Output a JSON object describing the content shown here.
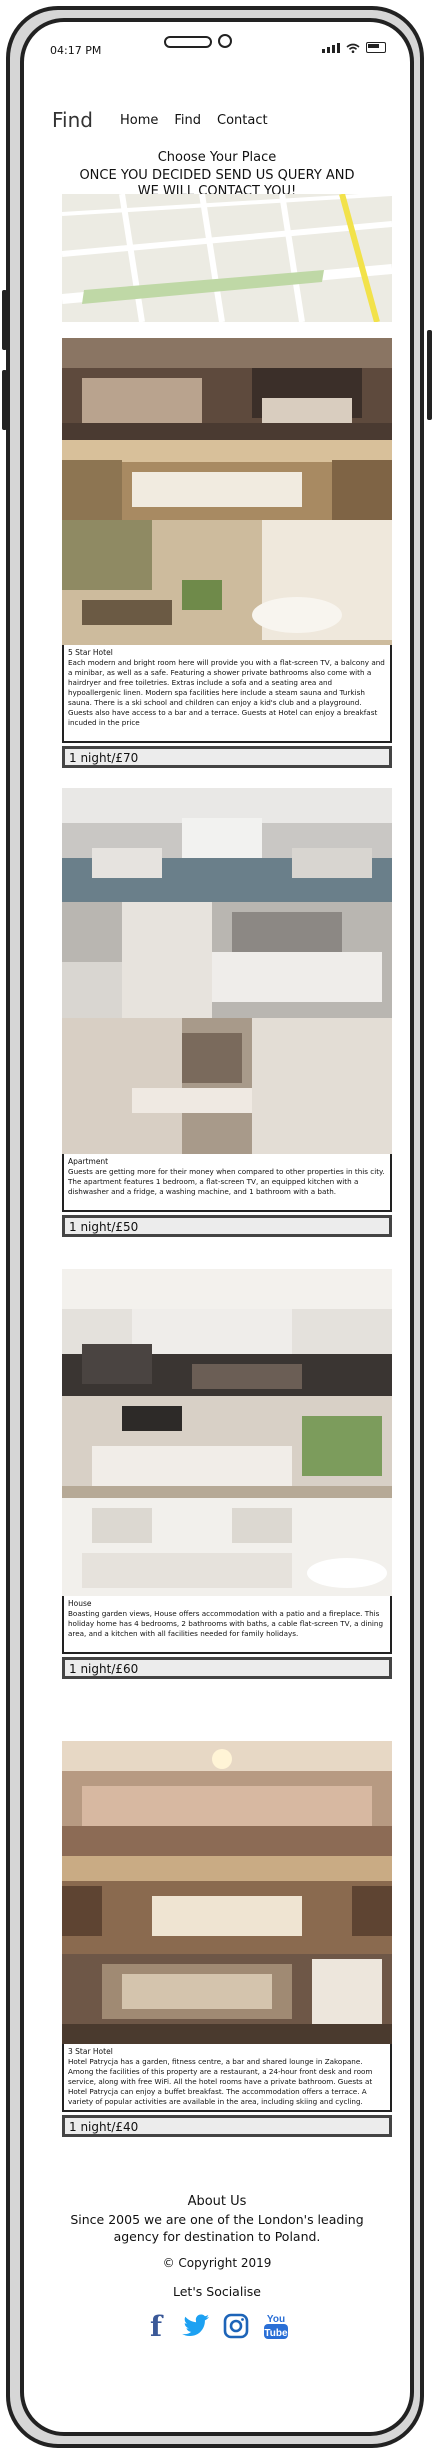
{
  "status": {
    "time": "04:17 PM"
  },
  "nav": {
    "brand": "Find",
    "links": [
      "Home",
      "Find",
      "Contact"
    ]
  },
  "hero": {
    "heading": "Choose Your Place",
    "line1": "ONCE YOU DECIDED SEND US QUERY AND",
    "line2": "WE WILL CONTACT YOU!"
  },
  "listings": [
    {
      "title": "5 Star Hotel",
      "description": "Each modern and bright room here will provide you with a flat-screen TV, a balcony and a minibar, as well as a safe. Featuring a shower private bathrooms also come with a hairdryer and free toiletries. Extras include a sofa and a seating area and hypoallergenic linen. Modern spa facilities here include a steam sauna and Turkish sauna. There is a ski school and children can enjoy a kid's club and a playground. Guests also have access to a bar and a terrace. Guests at Hotel can enjoy a breakfast incuded in the price",
      "price": "1 night/£70"
    },
    {
      "title": "Apartment",
      "description": "Guests are getting more for their money when compared to other properties in this city. The apartment features 1 bedroom, a flat-screen TV, an equipped kitchen with a dishwasher and a fridge, a washing machine, and 1 bathroom with a bath.",
      "price": "1 night/£50"
    },
    {
      "title": "House",
      "description": "Boasting garden views, House offers accommodation with a patio and a fireplace. This holiday home has 4 bedrooms, 2 bathrooms with baths, a cable flat-screen TV, a dining area, and a kitchen with all facilities needed for family holidays.",
      "price": "1 night/£60"
    },
    {
      "title": "3 Star Hotel",
      "description": "Hotel Patrycja has a garden, fitness centre, a bar and shared lounge in Zakopane. Among the facilities of this property are a restaurant, a 24-hour front desk and room service, along with free WiFi. All the hotel rooms have a private bathroom. Guests at Hotel Patrycja can enjoy a buffet breakfast. The accommodation offers a terrace. A variety of popular activities are available in the area, including skiing and cycling.",
      "price": "1 night/£40"
    }
  ],
  "footer": {
    "about_title": "About Us",
    "about_line1": "Since 2005 we are one of the London's leading",
    "about_line2": "agency for destination to Poland.",
    "copyright": "© Copyright 2019",
    "socialise": "Let's Socialise",
    "social_icons": [
      "facebook-icon",
      "twitter-icon",
      "instagram-icon",
      "youtube-icon"
    ]
  },
  "colors": {
    "facebook": "#3b5998",
    "twitter": "#1da1f2",
    "instagram": "#1d64b8",
    "youtube": "#2a6fd6"
  }
}
